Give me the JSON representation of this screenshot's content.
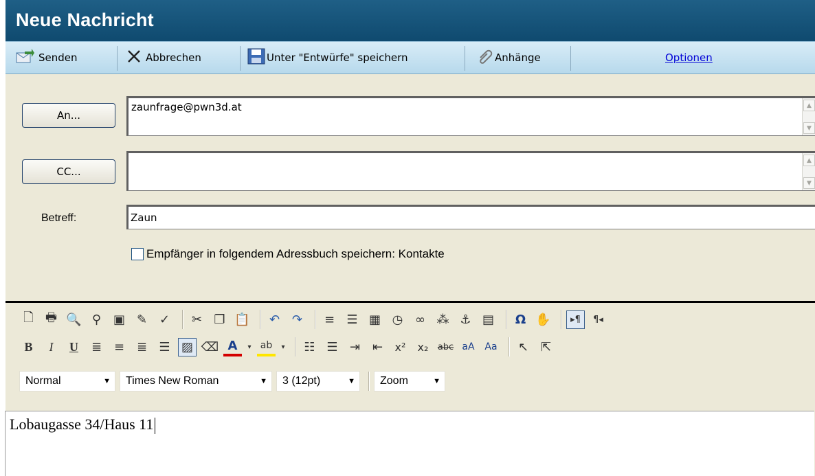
{
  "window": {
    "title": "Neue Nachricht"
  },
  "toolbar": {
    "send_label": "Senden",
    "cancel_label": "Abbrechen",
    "save_draft_label": "Unter \"Entwürfe\" speichern",
    "attach_label": "Anhänge",
    "options_label": "Optionen"
  },
  "header": {
    "to_button": "An...",
    "to_value": "zaunfrage@pwn3d.at",
    "cc_button": "CC...",
    "cc_value": "",
    "subject_label": "Betreff:",
    "subject_value": "Zaun",
    "save_contacts_label": "Empfänger in folgendem Adressbuch speichern: Kontakte",
    "save_contacts_checked": false
  },
  "editor": {
    "toolbar_row1_icons": [
      "new-document-icon",
      "print-icon",
      "preview-icon",
      "find-icon",
      "spellcheck-icon",
      "clean-icon",
      "check-spelling-icon",
      "cut-icon",
      "copy-icon",
      "paste-icon",
      "undo-icon",
      "redo-icon",
      "insert-paragraph-icon",
      "insert-line-icon",
      "insert-date-icon",
      "insert-time-icon",
      "link-icon",
      "unlink-icon",
      "anchor-icon",
      "table-icon",
      "special-char-icon",
      "image-icon",
      "rtl-icon",
      "ltr-icon"
    ],
    "toolbar_row2_icons": [
      "bold-icon",
      "italic-icon",
      "underline-icon",
      "align-left-icon",
      "align-center-icon",
      "align-right-icon",
      "align-justify-icon",
      "remove-format-icon",
      "eraser-icon",
      "font-color-icon",
      "highlight-icon",
      "ordered-list-icon",
      "unordered-list-icon",
      "indent-icon",
      "outdent-icon",
      "superscript-icon",
      "subscript-icon",
      "strikethrough-icon",
      "grow-font-icon",
      "shrink-font-icon",
      "select-all-icon",
      "deselect-icon"
    ],
    "paragraph_style": "Normal",
    "font_name": "Times New Roman",
    "font_size": "3 (12pt)",
    "zoom_label": "Zoom",
    "body_text": "Lobaugasse 34/Haus 11"
  }
}
